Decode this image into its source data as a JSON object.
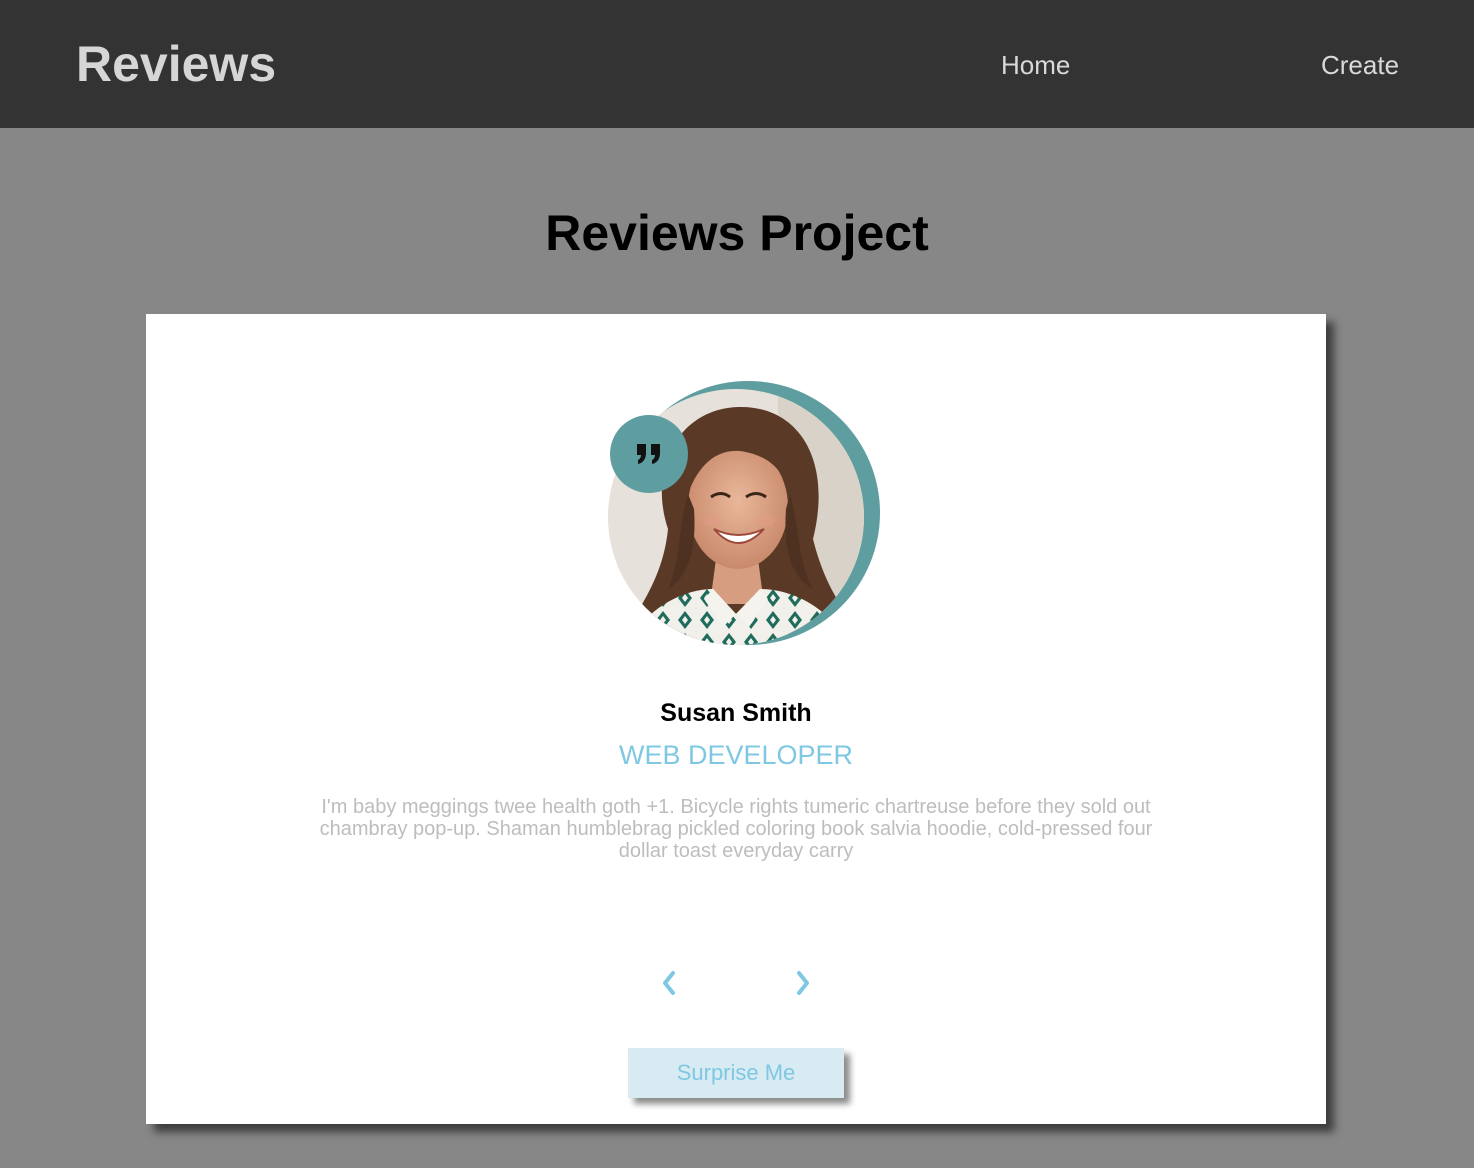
{
  "navbar": {
    "brand": "Reviews",
    "links": [
      {
        "label": "Home"
      },
      {
        "label": "Create"
      }
    ]
  },
  "page": {
    "title": "Reviews Project"
  },
  "review": {
    "name": "Susan Smith",
    "job": "WEB DEVELOPER",
    "text": "I'm baby meggings twee health goth +1. Bicycle rights tumeric chartreuse before they sold out chambray pop-up. Shaman humblebrag pickled coloring book salvia hoodie, cold-pressed four dollar toast everyday carry",
    "surprise_label": "Surprise Me",
    "icons": {
      "quote": "quote-right-icon",
      "prev": "chevron-left-icon",
      "next": "chevron-right-icon"
    }
  },
  "colors": {
    "navbar_bg": "#333333",
    "page_bg": "#878787",
    "accent": "#5f9ea0",
    "job_color": "#7ec8e3",
    "text_muted": "#bdbdbd",
    "button_bg": "#d8eaf2"
  }
}
